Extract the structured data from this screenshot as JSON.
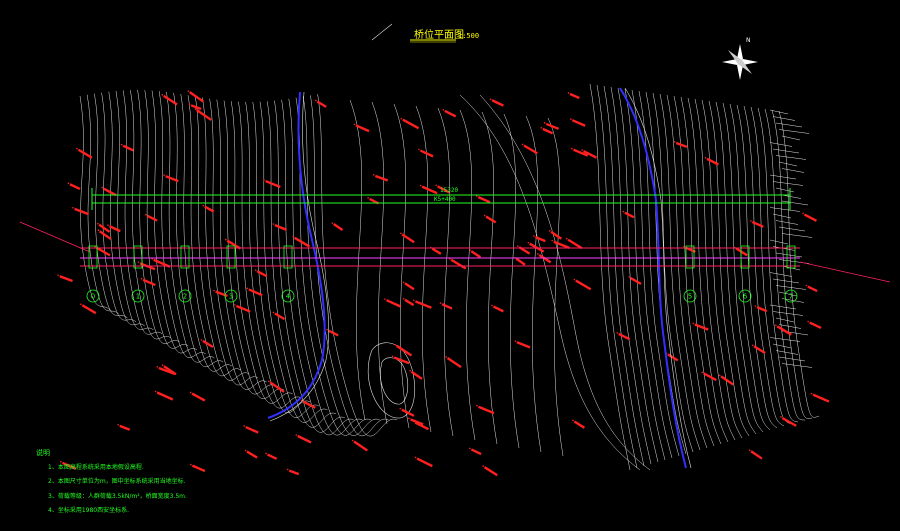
{
  "drawing": {
    "title": "桥位平面图",
    "scale": "1:500",
    "background": "#000000",
    "colors": {
      "contour": "#e6e6e6",
      "elevation": "#ff2020",
      "bridge_outline": "#ff2060",
      "bridge_line": "#22ff22",
      "river": "#3030ff",
      "pier_marker": "#22ff22",
      "survey": "#ff3030"
    },
    "bridge": {
      "length_label": "15320",
      "station_label": "K5+400"
    },
    "piers": [
      "0",
      "1",
      "2",
      "3",
      "4",
      "5",
      "6",
      "7"
    ],
    "compass": {
      "label": "N"
    }
  },
  "notes": {
    "heading": "说明",
    "items": [
      "1、本图高程系统采用本地假设高程.",
      "2、本图尺寸单位为m，图中坐标系统采用当地坐标.",
      "3、荷载等级：人群荷载3.5kN/m²，桥面宽度3.5m.",
      "4、坐标采用1980西安坐标系."
    ]
  }
}
